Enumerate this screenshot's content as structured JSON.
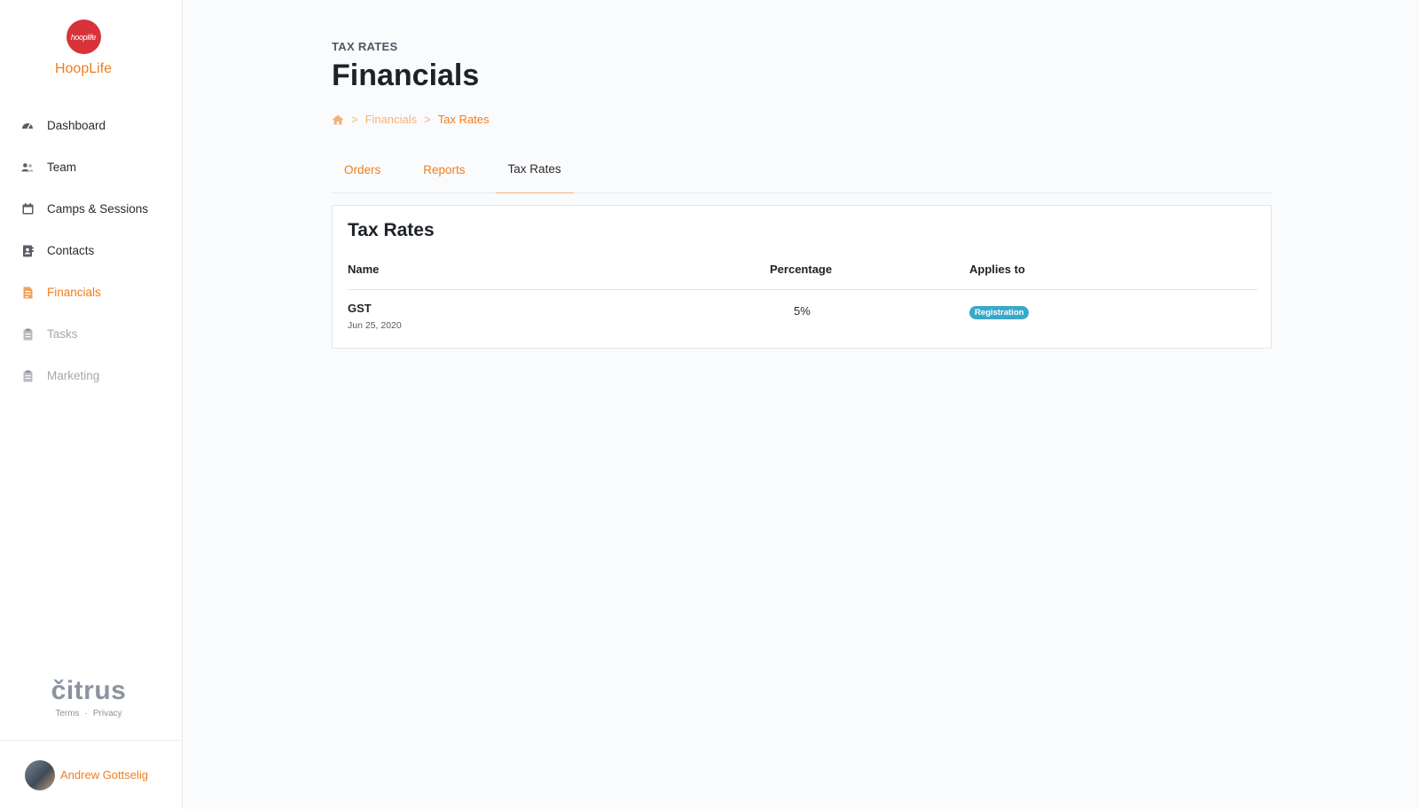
{
  "brand": {
    "logo_text": "hooplife",
    "name": "HoopLife"
  },
  "nav": {
    "items": [
      {
        "label": "Dashboard",
        "icon": "dashboard-gauge-icon",
        "state": "normal"
      },
      {
        "label": "Team",
        "icon": "users-icon",
        "state": "normal"
      },
      {
        "label": "Camps & Sessions",
        "icon": "calendar-icon",
        "state": "normal"
      },
      {
        "label": "Contacts",
        "icon": "address-book-icon",
        "state": "normal"
      },
      {
        "label": "Financials",
        "icon": "file-invoice-icon",
        "state": "active"
      },
      {
        "label": "Tasks",
        "icon": "clipboard-icon",
        "state": "disabled"
      },
      {
        "label": "Marketing",
        "icon": "clipboard-icon",
        "state": "disabled"
      }
    ]
  },
  "footer": {
    "brand": "čitrus",
    "terms": "Terms",
    "separator": "·",
    "privacy": "Privacy"
  },
  "user": {
    "name": "Andrew Gottselig"
  },
  "header": {
    "eyebrow": "TAX RATES",
    "title": "Financials",
    "breadcrumb": {
      "sep": ">",
      "items": [
        "Financials",
        "Tax Rates"
      ]
    }
  },
  "tabs": [
    {
      "label": "Orders",
      "active": false
    },
    {
      "label": "Reports",
      "active": false
    },
    {
      "label": "Tax Rates",
      "active": true
    }
  ],
  "card": {
    "title": "Tax Rates",
    "columns": {
      "name": "Name",
      "percentage": "Percentage",
      "applies_to": "Applies to"
    },
    "rows": [
      {
        "name": "GST",
        "date": "Jun 25, 2020",
        "percentage": "5%",
        "applies_to": "Registration"
      }
    ]
  },
  "colors": {
    "accent": "#f07e1b",
    "accent_light": "#f5b27a",
    "badge": "#3aa8c9",
    "logo": "#d8333a"
  }
}
